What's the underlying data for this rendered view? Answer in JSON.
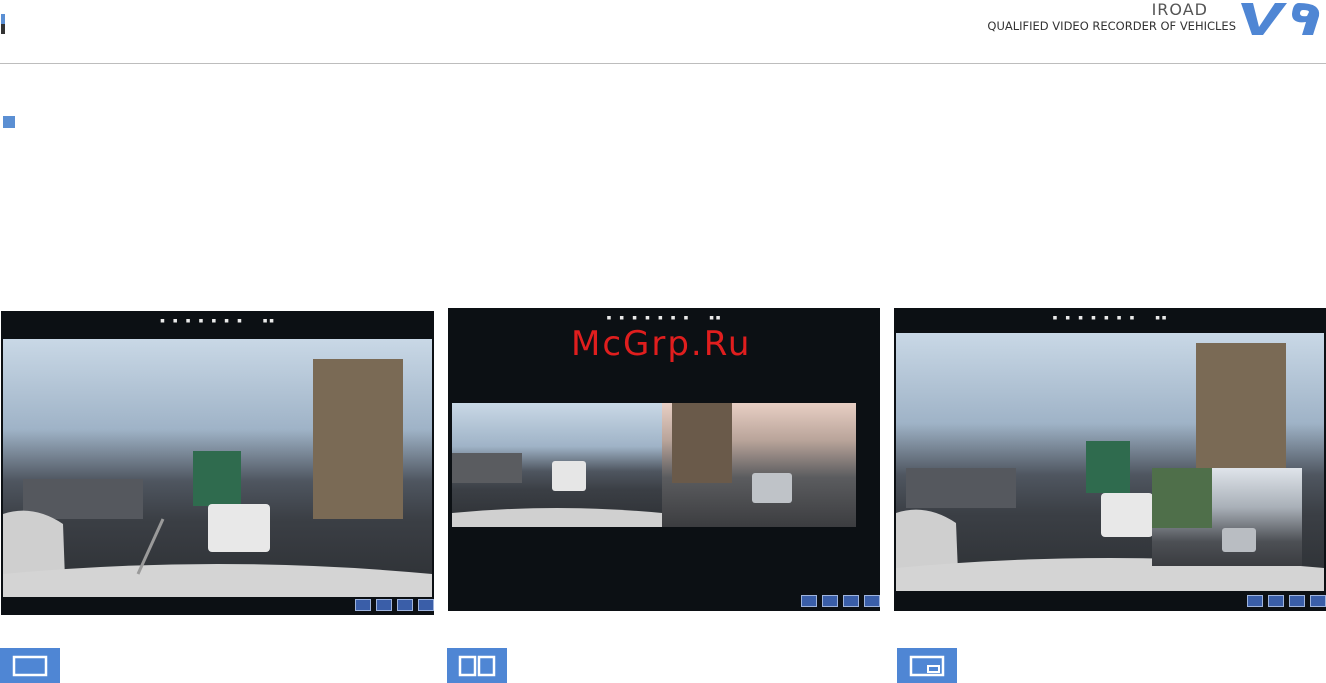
{
  "header": {
    "brand_name": "IROAD",
    "tagline": "QUALIFIED VIDEO RECORDER OF VEHICLES",
    "logo_text": "V9",
    "accent_color": "#5b8fd3"
  },
  "watermark": "McGrp.Ru",
  "screens": [
    {
      "mode": "single-view",
      "icon": "single-screen-icon"
    },
    {
      "mode": "split-view",
      "icon": "split-screen-icon"
    },
    {
      "mode": "picture-in-picture",
      "icon": "pip-screen-icon"
    }
  ]
}
